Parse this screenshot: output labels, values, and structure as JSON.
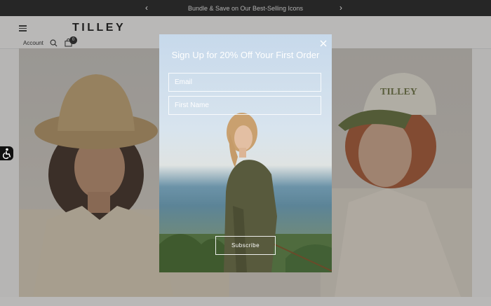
{
  "announcement": {
    "text": "Bundle & Save on Our Best-Selling Icons"
  },
  "header": {
    "logo": "TILLEY",
    "account_label": "Account",
    "cart_count": "0"
  },
  "hero": {
    "left_hat_text": "",
    "right_hat_text": "TILLEY"
  },
  "popup": {
    "title": "Sign Up for 20% Off Your First Order",
    "email_placeholder": "Email",
    "first_name_placeholder": "First Name",
    "subscribe_label": "Subscribe"
  },
  "colors": {
    "announcement_bg": "#1c1c1c",
    "overlay": "rgba(60,60,60,0.32)",
    "cap_green": "#5f6a36"
  }
}
